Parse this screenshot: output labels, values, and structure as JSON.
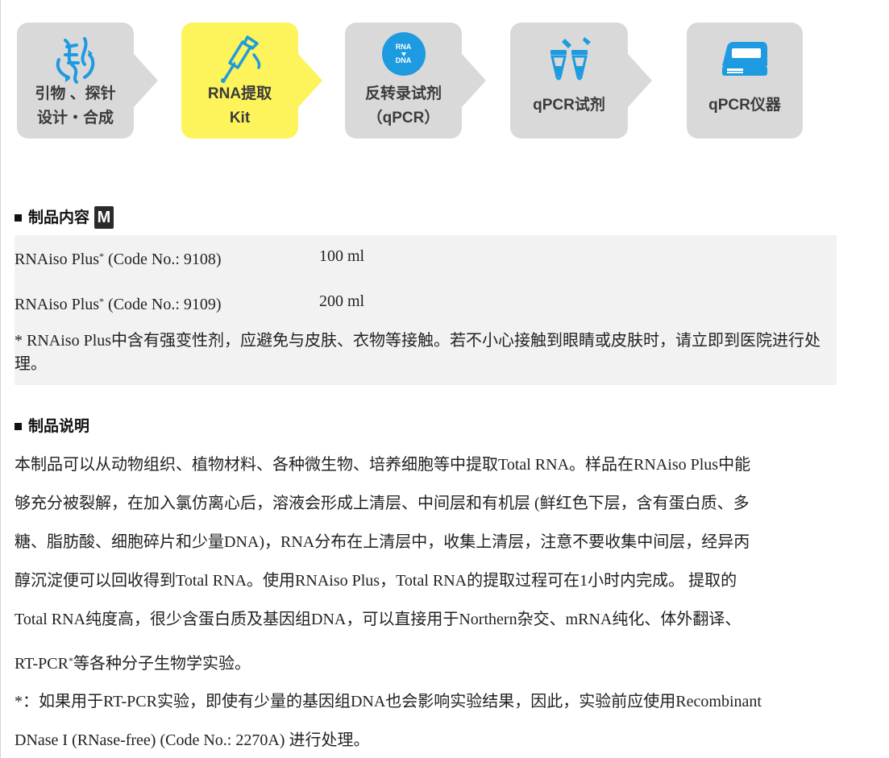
{
  "workflow": {
    "steps": [
      {
        "line1": "引物 、探针",
        "line2": "设计・合成",
        "icon": "dna-helix-icon",
        "active": false
      },
      {
        "line1": "RNA提取",
        "line2": "Kit",
        "icon": "pipette-tube-icon",
        "active": true
      },
      {
        "line1": "反转录试剂",
        "line2": "（qPCR）",
        "icon": "rna-to-dna-icon",
        "active": false,
        "icon_text_top": "RNA",
        "icon_text_bottom": "DNA"
      },
      {
        "line1": "qPCR试剂",
        "line2": "",
        "icon": "pcr-tubes-icon",
        "active": false
      },
      {
        "line1": "qPCR仪器",
        "line2": "",
        "icon": "pcr-instrument-icon",
        "active": false
      }
    ],
    "colors": {
      "inactive": "#d9d9d9",
      "active": "#fdf35a",
      "icon_blue": "#1e9be0"
    }
  },
  "contents": {
    "heading": "制品内容",
    "badge": "M",
    "items": [
      {
        "name": "RNAiso Plus",
        "mark": "*",
        "code": "(Code No.: 9108)",
        "volume": "100 ml"
      },
      {
        "name": "RNAiso Plus",
        "mark": "*",
        "code": "(Code No.: 9109)",
        "volume": "200 ml"
      }
    ],
    "note": "* RNAiso Plus中含有强变性剂，应避免与皮肤、衣物等接触。若不小心接触到眼睛或皮肤时，请立即到医院进行处理。"
  },
  "description": {
    "heading": "制品说明",
    "lines": [
      "本制品可以从动物组织、植物材料、各种微生物、培养细胞等中提取Total RNA。样品在RNAiso Plus中能",
      "够充分被裂解，在加入氯仿离心后，溶液会形成上清层、中间层和有机层 (鲜红色下层，含有蛋白质、多",
      "糖、脂肪酸、细胞碎片和少量DNA)，RNA分布在上清层中，收集上清层，注意不要收集中间层，经异丙",
      "醇沉淀便可以回收得到Total RNA。使用RNAiso Plus，Total RNA的提取过程可在1小时内完成。 提取的",
      "Total RNA纯度高，很少含蛋白质及基因组DNA，可以直接用于Northern杂交、mRNA纯化、体外翻译、"
    ],
    "line6_pre": "RT-PCR",
    "line6_mark": "*",
    "line6_post": "等各种分子生物学实验。",
    "footnote_lines": [
      "*：如果用于RT-PCR实验，即使有少量的基因组DNA也会影响实验结果，因此，实验前应使用Recombinant",
      "DNase I (RNase-free) (Code No.: 2270A) 进行处理。"
    ]
  }
}
